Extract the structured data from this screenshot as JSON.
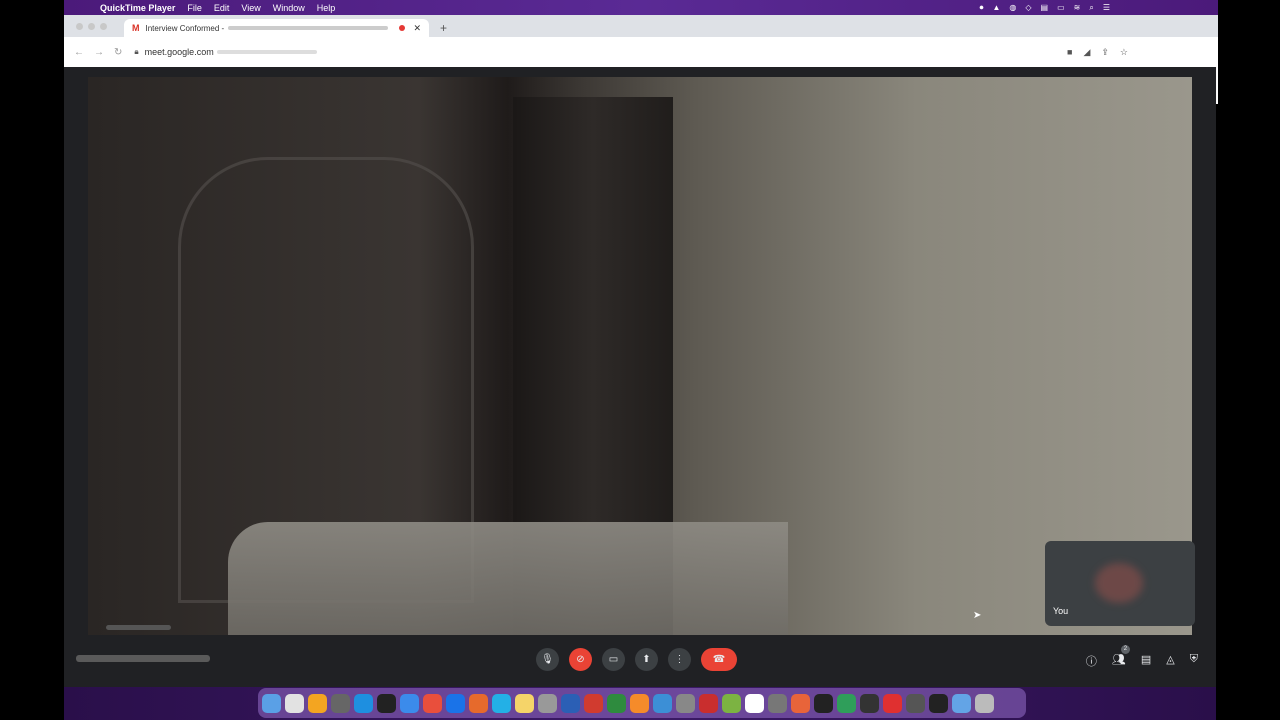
{
  "menubar": {
    "app_name": "QuickTime Player",
    "items": [
      "File",
      "Edit",
      "View",
      "Window",
      "Help"
    ]
  },
  "browser": {
    "tab_title": "Interview Conformed -",
    "url": "meet.google.com"
  },
  "meet": {
    "self_tile_label": "You",
    "participant_count": "2"
  },
  "colors": {
    "menubar": "#4b1a7a",
    "meet_bg": "#202124",
    "leave_red": "#ea4335",
    "speaking_blue": "#1a73e8"
  },
  "dock_colors": [
    "#5aa0e6",
    "#e2e2e2",
    "#f3a521",
    "#666",
    "#1e8fe0",
    "#222",
    "#3b8beb",
    "#e94f3c",
    "#1a73e8",
    "#e66a2c",
    "#23b0e6",
    "#f5d469",
    "#999",
    "#2b5fb5",
    "#d13b2f",
    "#2e8b3e",
    "#f58b2a",
    "#3c8fd6",
    "#888",
    "#c92e2e",
    "#7cb342",
    "#fff",
    "#777",
    "#e8643a",
    "#222",
    "#2f9e5a",
    "#333",
    "#e03030",
    "#555",
    "#222",
    "#63a4e6",
    "#bbb"
  ]
}
